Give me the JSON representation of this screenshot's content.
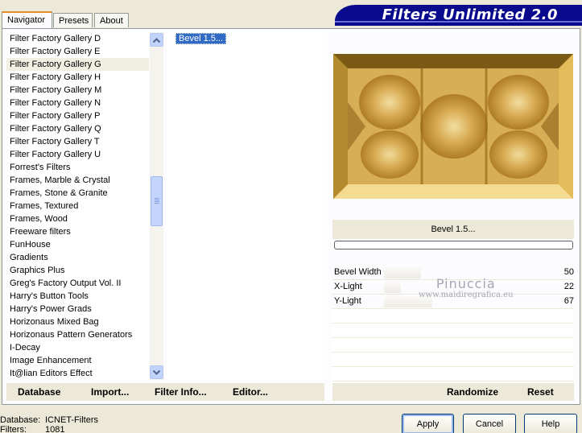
{
  "window": {
    "banner_title": "Filters Unlimited 2.0"
  },
  "tabs": [
    {
      "label": "Navigator",
      "active": true
    },
    {
      "label": "Presets"
    },
    {
      "label": "About"
    }
  ],
  "categories": {
    "items": [
      "Filter Factory Gallery D",
      "Filter Factory Gallery E",
      "Filter Factory Gallery G",
      "Filter Factory Gallery H",
      "Filter Factory Gallery M",
      "Filter Factory Gallery N",
      "Filter Factory Gallery P",
      "Filter Factory Gallery Q",
      "Filter Factory Gallery T",
      "Filter Factory Gallery U",
      "Forrest's Filters",
      "Frames, Marble & Crystal",
      "Frames, Stone & Granite",
      "Frames, Textured",
      "Frames, Wood",
      "Freeware filters",
      "FunHouse",
      "Gradients",
      "Graphics Plus",
      "Greg's Factory Output Vol. II",
      "Harry's Button Tools",
      "Harry's Power Grads",
      "Horizonaus Mixed Bag",
      "Horizonaus Pattern Generators",
      "I-Decay",
      "Image Enhancement",
      "It@lian Editors Effect"
    ],
    "selected": "Filter Factory Gallery G"
  },
  "filters": {
    "selected": "Bevel 1.5..."
  },
  "preview": {
    "filter_name": "Bevel 1.5...",
    "progress": 0
  },
  "parameters": [
    {
      "label": "Bevel Width",
      "value": "50",
      "fraction": 0.2
    },
    {
      "label": "X-Light",
      "value": "22",
      "fraction": 0.09
    },
    {
      "label": "Y-Light",
      "value": "67",
      "fraction": 0.26
    }
  ],
  "watermark": {
    "name": "Pinuccia",
    "site": "www.maidiregrafica.eu"
  },
  "left_commands": {
    "database": "Database",
    "import": "Import...",
    "filter_info": "Filter Info...",
    "editor": "Editor..."
  },
  "right_commands": {
    "randomize": "Randomize",
    "reset": "Reset"
  },
  "status": {
    "database_label": "Database:",
    "database_value": "ICNET-Filters",
    "filters_label": "Filters:",
    "filters_value": "1081"
  },
  "buttons": {
    "apply": "Apply",
    "cancel": "Cancel",
    "help": "Help"
  },
  "colors": {
    "banner": "#0a0a8c",
    "selection": "#316ac5",
    "gold": "#d9a540"
  }
}
